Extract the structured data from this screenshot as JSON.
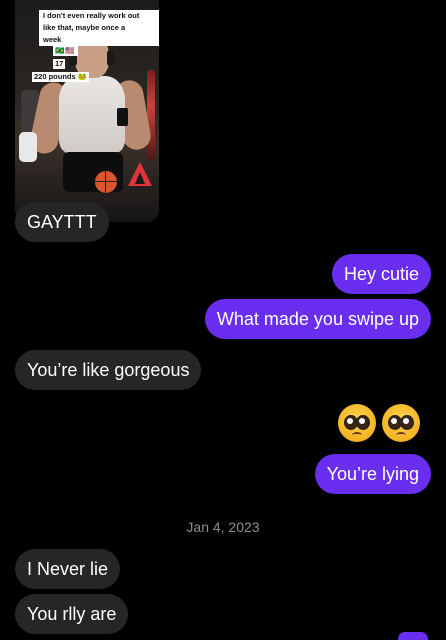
{
  "story": {
    "caption_lines": [
      "I don't even really work out",
      "like that, maybe once a",
      "week"
    ],
    "flags": "🇧🇷🇺🇸",
    "age": "17",
    "weight": "220 pounds 🐸"
  },
  "messages": {
    "m1": "GAYTTT",
    "m2": "Hey cutie",
    "m3": "What made you swipe up",
    "m4": "You’re like gorgeous",
    "m5": "You’re lying",
    "m6": "I Never lie",
    "m7": "You rlly are"
  },
  "date_separator": "Jan 4, 2023",
  "emojis": [
    "pleading-face",
    "pleading-face"
  ],
  "colors": {
    "outgoing": "#6a2ef0",
    "incoming": "#262628",
    "background": "#000000"
  }
}
